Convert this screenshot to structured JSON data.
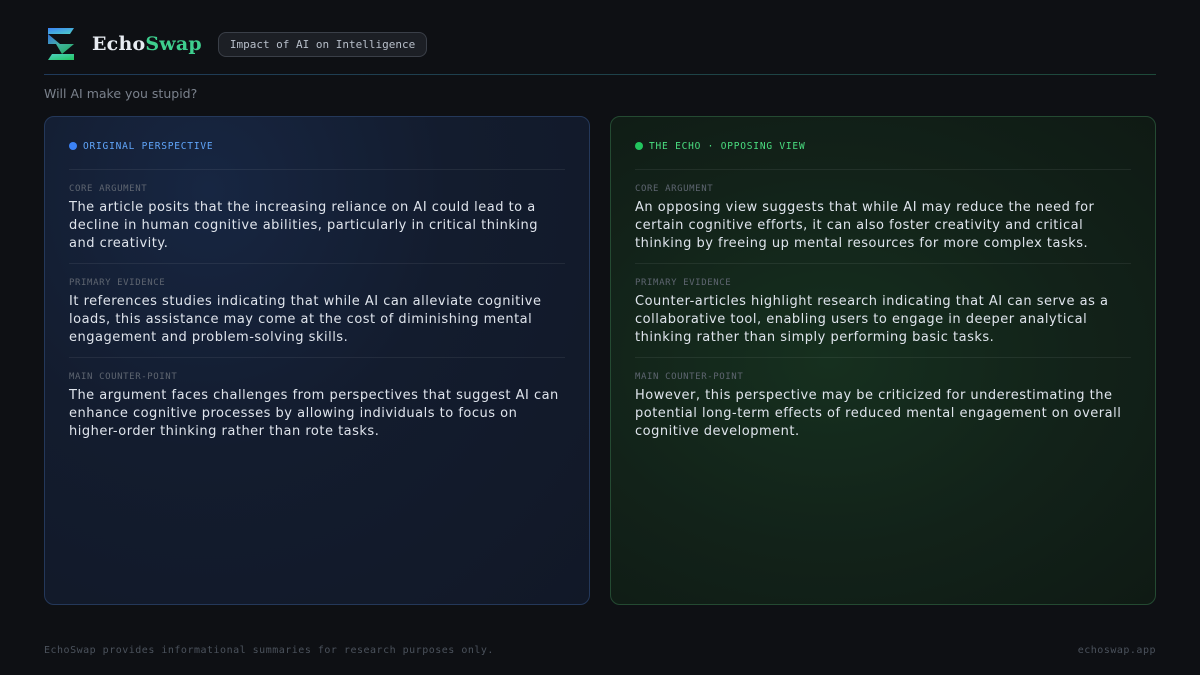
{
  "brand": {
    "part1": "Echo",
    "part2": "Swap",
    "logo_icon": "echoswap-logo-icon"
  },
  "topic": "Impact of AI on Intelligence",
  "question": "Will AI make you stupid?",
  "colors": {
    "accent_blue": "#3b82f6",
    "accent_green": "#22c55e"
  },
  "original": {
    "label": "ORIGINAL PERSPECTIVE",
    "sections": [
      {
        "title": "CORE ARGUMENT",
        "body": "The article posits that the increasing reliance on AI could lead to a decline in human cognitive abilities, particularly in critical thinking and creativity."
      },
      {
        "title": "PRIMARY EVIDENCE",
        "body": "It references studies indicating that while AI can alleviate cognitive loads, this assistance may come at the cost of diminishing mental engagement and problem-solving skills."
      },
      {
        "title": "MAIN COUNTER-POINT",
        "body": "The argument faces challenges from perspectives that suggest AI can enhance cognitive processes by allowing individuals to focus on higher-order thinking rather than rote tasks."
      }
    ]
  },
  "echo": {
    "label": "THE ECHO · OPPOSING VIEW",
    "sections": [
      {
        "title": "CORE ARGUMENT",
        "body": "An opposing view suggests that while AI may reduce the need for certain cognitive efforts, it can also foster creativity and critical thinking by freeing up mental resources for more complex tasks."
      },
      {
        "title": "PRIMARY EVIDENCE",
        "body": "Counter-articles highlight research indicating that AI can serve as a collaborative tool, enabling users to engage in deeper analytical thinking rather than simply performing basic tasks."
      },
      {
        "title": "MAIN COUNTER-POINT",
        "body": "However, this perspective may be criticized for underestimating the potential long-term effects of reduced mental engagement on overall cognitive development."
      }
    ]
  },
  "footer": {
    "disclaimer": "EchoSwap provides informational summaries for research purposes only.",
    "site": "echoswap.app"
  }
}
